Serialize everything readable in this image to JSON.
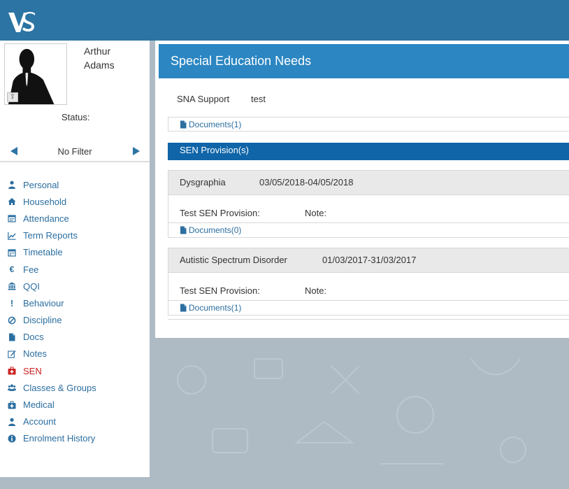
{
  "app": {
    "logo_text": "VS",
    "colors": {
      "topbar": "#2b74a3",
      "header": "#2b86c2",
      "provision_header": "#0f65a8",
      "link": "#2b6ea0",
      "active": "#c8211f"
    }
  },
  "profile": {
    "first_name": "Arthur",
    "last_name": "Adams",
    "status_label": "Status:",
    "filter_label": "No Filter"
  },
  "sidebar": {
    "items": [
      {
        "label": "Personal",
        "icon": "person-icon"
      },
      {
        "label": "Household",
        "icon": "home-icon"
      },
      {
        "label": "Attendance",
        "icon": "calendar-icon"
      },
      {
        "label": "Term Reports",
        "icon": "line-chart-icon"
      },
      {
        "label": "Timetable",
        "icon": "calendar-icon"
      },
      {
        "label": "Fee",
        "icon": "euro-icon"
      },
      {
        "label": "QQI",
        "icon": "bank-icon"
      },
      {
        "label": "Behaviour",
        "icon": "exclamation-icon"
      },
      {
        "label": "Discipline",
        "icon": "ban-icon"
      },
      {
        "label": "Docs",
        "icon": "file-icon"
      },
      {
        "label": "Notes",
        "icon": "edit-icon"
      },
      {
        "label": "SEN",
        "icon": "medkit-icon",
        "active": true
      },
      {
        "label": "Classes & Groups",
        "icon": "group-icon"
      },
      {
        "label": "Medical",
        "icon": "medkit-icon"
      },
      {
        "label": "Account",
        "icon": "person-icon"
      },
      {
        "label": "Enrolment History",
        "icon": "info-icon"
      }
    ]
  },
  "main": {
    "title": "Special Education Needs",
    "sna_label": "SNA Support",
    "sna_value": "test",
    "documents_link": "Documents(1)",
    "provisions_title": "SEN Provision(s)",
    "provisions": [
      {
        "name": "Dysgraphia",
        "dates": "03/05/2018-04/05/2018",
        "label": "Test SEN Provision:",
        "note_label": "Note:",
        "documents": "Documents(0)"
      },
      {
        "name": "Autistic Spectrum Disorder",
        "dates": "01/03/2017-31/03/2017",
        "label": "Test SEN Provision:",
        "note_label": "Note:",
        "documents": "Documents(1)"
      }
    ]
  }
}
